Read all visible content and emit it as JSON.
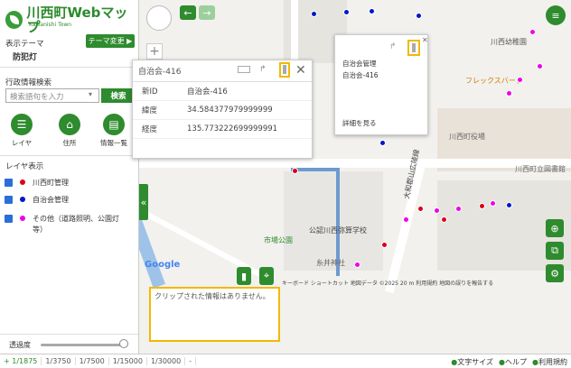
{
  "app": {
    "title": "川西町Webマップ",
    "subtitle": "Kawanishi Town"
  },
  "theme": {
    "label": "表示テーマ",
    "value": "防犯灯",
    "change_button": "テーマ変更 ▶"
  },
  "search": {
    "section_label": "行政情報検索",
    "placeholder": "検索語句を入力",
    "button": "検索"
  },
  "tools": [
    {
      "label": "レイヤ",
      "icon": "list-icon"
    },
    {
      "label": "住所",
      "icon": "home-icon"
    },
    {
      "label": "情報一覧",
      "icon": "table-icon"
    }
  ],
  "layers": {
    "title": "レイヤ表示",
    "items": [
      {
        "label": "川西町管理",
        "color": "#d9001b"
      },
      {
        "label": "自治会管理",
        "color": "#0017c9"
      },
      {
        "label": "その他（道路照明、公園灯等）",
        "color": "#ee00e8"
      }
    ]
  },
  "opacity": {
    "label": "透過度",
    "level": 1.0
  },
  "popup_main": {
    "title": "自治会-416",
    "rows": [
      {
        "key": "新ID",
        "value": "自治会-416"
      },
      {
        "key": "緯度",
        "value": "34.584377979999999"
      },
      {
        "key": "経度",
        "value": "135.773222699999991"
      }
    ]
  },
  "popup_small": {
    "line1": "自治会管理",
    "line2": "自治会-416",
    "more": "詳細を見る"
  },
  "clip": {
    "message": "クリップされた情報はありません。"
  },
  "map_labels": {
    "kindergarten": "川西幼稚園",
    "flex": "フレックスバーク",
    "town_hall": "川西町役場",
    "library": "川西町立図書館",
    "road": "大和郡山広陵線",
    "school": "公認川西弥算学校",
    "park": "市場公園",
    "shrine": "糸井神社",
    "attribution": "キーボード ショートカット   地図データ ©2025   20 m   利用規約   地図の誤りを報告する",
    "google": "Google"
  },
  "scales": [
    "1/1875",
    "1/3750",
    "1/7500",
    "1/15000",
    "1/30000"
  ],
  "footer": {
    "text_size": "文字サイズ",
    "help": "ヘルプ",
    "terms": "利用規約"
  }
}
